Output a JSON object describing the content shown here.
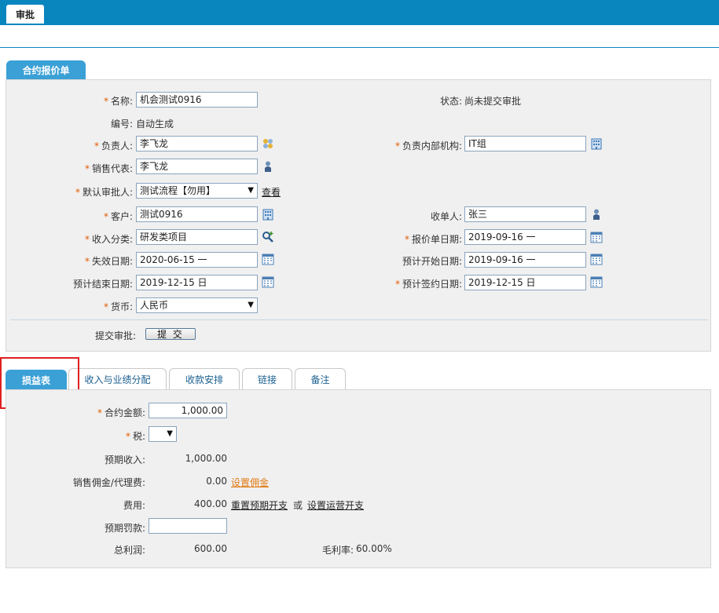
{
  "topbar": {
    "tab_label": "审批"
  },
  "section_tab": "合约报价单",
  "form": {
    "name_label": "名称:",
    "name_value": "机会测试0916",
    "status_label": "状态:",
    "status_value": "尚未提交审批",
    "code_label": "编号:",
    "code_value": "自动生成",
    "owner_label": "负责人:",
    "owner_value": "李飞龙",
    "owner_dept_label": "负责内部机构:",
    "owner_dept_value": "IT组",
    "sales_rep_label": "销售代表:",
    "sales_rep_value": "李飞龙",
    "approver_label": "默认审批人:",
    "approver_value": "测试流程【勿用】",
    "approver_view_link": "查看",
    "customer_label": "客户:",
    "customer_value": "测试0916",
    "receiver_label": "收单人:",
    "receiver_value": "张三",
    "income_type_label": "收入分类:",
    "income_type_value": "研发类项目",
    "quote_date_label": "报价单日期:",
    "quote_date_value": "2019-09-16 一",
    "expire_date_label": "失效日期:",
    "expire_date_value": "2020-06-15 一",
    "start_date_label": "预计开始日期:",
    "start_date_value": "2019-09-16 一",
    "end_date_label": "预计结束日期:",
    "end_date_value": "2019-12-15 日",
    "sign_date_label": "预计签约日期:",
    "sign_date_value": "2019-12-15 日",
    "currency_label": "货币:",
    "currency_value": "人民币",
    "submit_label": "提交审批:",
    "submit_button": "提 交"
  },
  "tabs": [
    "损益表",
    "收入与业绩分配",
    "收款安排",
    "链接",
    "备注"
  ],
  "pnl": {
    "amount_label": "合约金额:",
    "amount_value": "1,000.00",
    "tax_label": "税:",
    "expected_income_label": "预期收入:",
    "expected_income_value": "1,000.00",
    "commission_label": "销售佣金/代理费:",
    "commission_value": "0.00",
    "commission_link": "设置佣金",
    "cost_label": "费用:",
    "cost_value": "400.00",
    "reset_cost_link": "重置预期开支",
    "or_text": "或",
    "set_ops_cost_link": "设置运营开支",
    "penalty_label": "预期罚款:",
    "penalty_value": "",
    "total_profit_label": "总利润:",
    "total_profit_value": "600.00",
    "margin_label": "毛利率:",
    "margin_value": "60.00%"
  },
  "colors": {
    "header_blue": "#0a86bf",
    "tab_blue": "#3aa0d6",
    "required": "#e35b00",
    "highlight_box": "#e02020"
  }
}
